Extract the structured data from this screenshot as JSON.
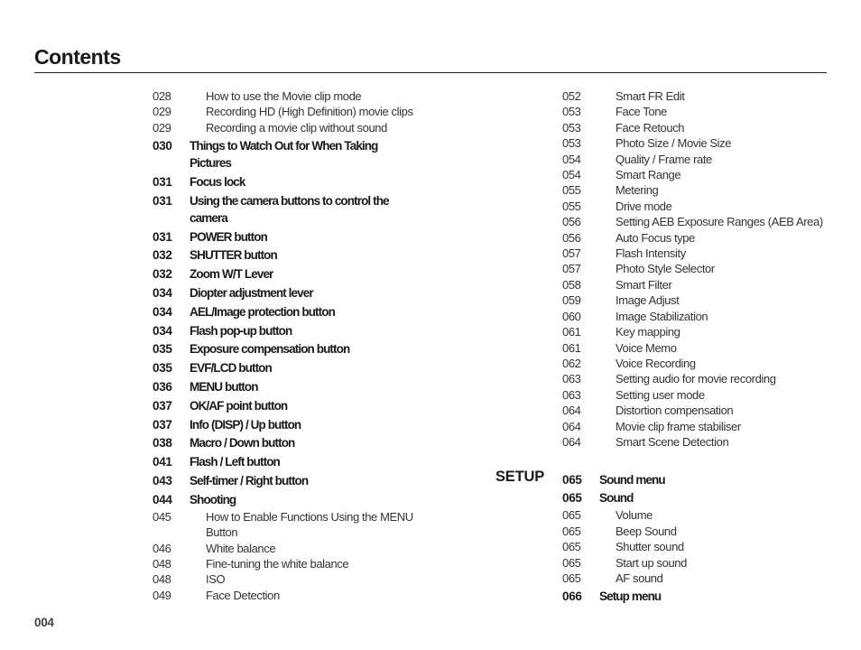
{
  "page": {
    "title": "Contents",
    "page_number": "004"
  },
  "left_column": [
    {
      "page": "028",
      "text": "How to use the Movie clip mode",
      "level": "sub"
    },
    {
      "page": "029",
      "text": "Recording HD (High Definition) movie clips",
      "level": "sub"
    },
    {
      "page": "029",
      "text": "Recording a movie clip without sound",
      "level": "sub"
    },
    {
      "page": "030",
      "text": "Things to Watch Out for When Taking Pictures",
      "level": "main"
    },
    {
      "page": "031",
      "text": "Focus lock",
      "level": "main"
    },
    {
      "page": "031",
      "text": "Using the camera buttons to control the camera",
      "level": "main"
    },
    {
      "page": "031",
      "text": "POWER button",
      "level": "main"
    },
    {
      "page": "032",
      "text": "SHUTTER button",
      "level": "main"
    },
    {
      "page": "032",
      "text": "Zoom W/T Lever",
      "level": "main"
    },
    {
      "page": "034",
      "text": "Diopter adjustment lever",
      "level": "main"
    },
    {
      "page": "034",
      "text": "AEL/Image protection button",
      "level": "main"
    },
    {
      "page": "034",
      "text": "Flash pop-up button",
      "level": "main"
    },
    {
      "page": "035",
      "text": "Exposure compensation button",
      "level": "main"
    },
    {
      "page": "035",
      "text": "EVF/LCD button",
      "level": "main"
    },
    {
      "page": "036",
      "text": "MENU button",
      "level": "main"
    },
    {
      "page": "037",
      "text": "OK/AF point button",
      "level": "main"
    },
    {
      "page": "037",
      "text": "Info (DISP) / Up button",
      "level": "main"
    },
    {
      "page": "038",
      "text": "Macro / Down button",
      "level": "main"
    },
    {
      "page": "041",
      "text": "Flash / Left button",
      "level": "main"
    },
    {
      "page": "043",
      "text": "Self-timer / Right button",
      "level": "main"
    },
    {
      "page": "044",
      "text": "Shooting",
      "level": "main"
    },
    {
      "page": "045",
      "text": "How to Enable Functions Using the MENU Button",
      "level": "sub"
    },
    {
      "page": "046",
      "text": "White balance",
      "level": "sub"
    },
    {
      "page": "048",
      "text": "Fine-tuning the white balance",
      "level": "sub"
    },
    {
      "page": "048",
      "text": "ISO",
      "level": "sub"
    },
    {
      "page": "049",
      "text": "Face Detection",
      "level": "sub"
    }
  ],
  "right_column": [
    {
      "page": "052",
      "text": "Smart FR Edit",
      "level": "sub"
    },
    {
      "page": "053",
      "text": "Face Tone",
      "level": "sub"
    },
    {
      "page": "053",
      "text": "Face Retouch",
      "level": "sub"
    },
    {
      "page": "053",
      "text": "Photo Size / Movie Size",
      "level": "sub"
    },
    {
      "page": "054",
      "text": "Quality / Frame rate",
      "level": "sub"
    },
    {
      "page": "054",
      "text": "Smart Range",
      "level": "sub"
    },
    {
      "page": "055",
      "text": "Metering",
      "level": "sub"
    },
    {
      "page": "055",
      "text": "Drive mode",
      "level": "sub"
    },
    {
      "page": "056",
      "text": "Setting AEB Exposure Ranges (AEB Area)",
      "level": "sub"
    },
    {
      "page": "056",
      "text": "Auto Focus type",
      "level": "sub"
    },
    {
      "page": "057",
      "text": "Flash Intensity",
      "level": "sub"
    },
    {
      "page": "057",
      "text": "Photo Style Selector",
      "level": "sub"
    },
    {
      "page": "058",
      "text": "Smart Filter",
      "level": "sub"
    },
    {
      "page": "059",
      "text": "Image Adjust",
      "level": "sub"
    },
    {
      "page": "060",
      "text": "Image Stabilization",
      "level": "sub"
    },
    {
      "page": "061",
      "text": "Key mapping",
      "level": "sub"
    },
    {
      "page": "061",
      "text": "Voice Memo",
      "level": "sub"
    },
    {
      "page": "062",
      "text": "Voice Recording",
      "level": "sub"
    },
    {
      "page": "063",
      "text": "Setting audio for movie recording",
      "level": "sub"
    },
    {
      "page": "063",
      "text": "Setting user mode",
      "level": "sub"
    },
    {
      "page": "064",
      "text": "Distortion compensation",
      "level": "sub"
    },
    {
      "page": "064",
      "text": "Movie clip frame stabiliser",
      "level": "sub"
    },
    {
      "page": "064",
      "text": "Smart Scene Detection",
      "level": "sub"
    }
  ],
  "setup_section": {
    "label": "SETUP",
    "entries": [
      {
        "page": "065",
        "text": "Sound menu",
        "level": "main"
      },
      {
        "page": "065",
        "text": "Sound",
        "level": "main"
      },
      {
        "page": "065",
        "text": "Volume",
        "level": "sub"
      },
      {
        "page": "065",
        "text": "Beep Sound",
        "level": "sub"
      },
      {
        "page": "065",
        "text": "Shutter sound",
        "level": "sub"
      },
      {
        "page": "065",
        "text": "Start up sound",
        "level": "sub"
      },
      {
        "page": "065",
        "text": "AF sound",
        "level": "sub"
      },
      {
        "page": "066",
        "text": "Setup menu",
        "level": "main"
      }
    ]
  }
}
